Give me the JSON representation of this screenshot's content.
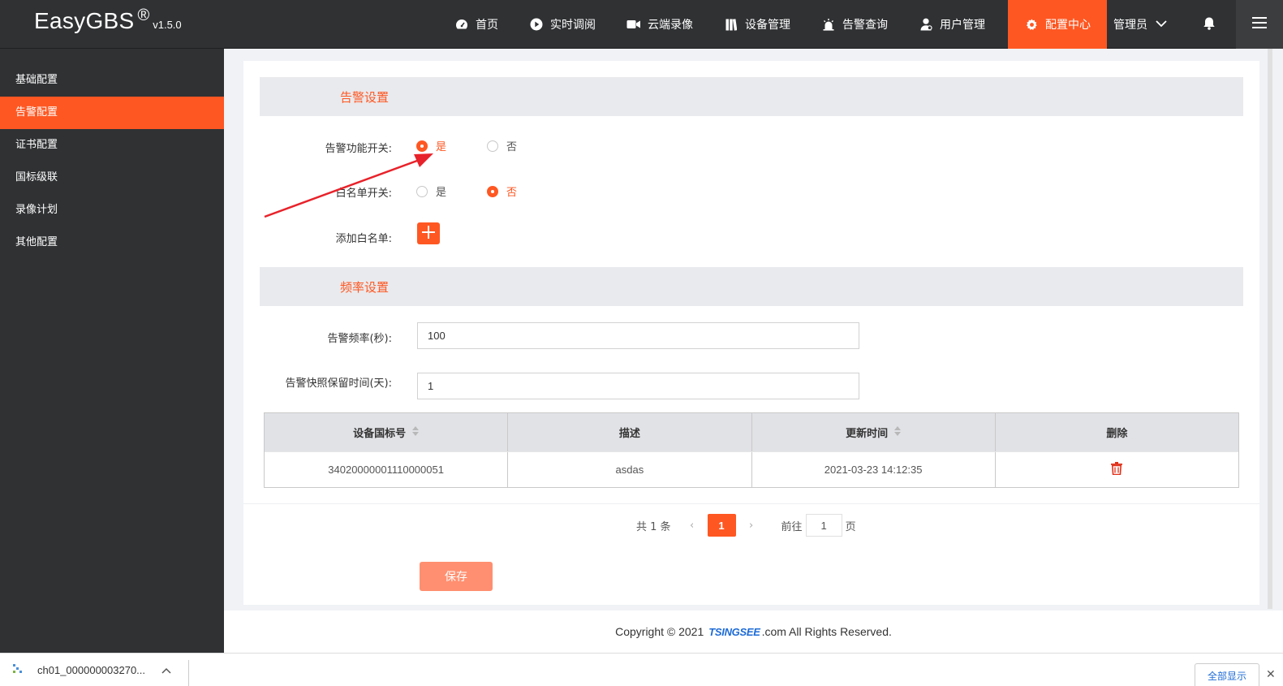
{
  "app": {
    "name": "EasyGBS",
    "reg_mark": "®",
    "version": "v1.5.0"
  },
  "nav": {
    "items": [
      {
        "label": "首页",
        "icon": "dashboard-icon"
      },
      {
        "label": "实时调阅",
        "icon": "play-icon"
      },
      {
        "label": "云端录像",
        "icon": "video-camera-icon"
      },
      {
        "label": "设备管理",
        "icon": "device-icon"
      },
      {
        "label": "告警查询",
        "icon": "alarm-icon"
      },
      {
        "label": "用户管理",
        "icon": "user-icon"
      },
      {
        "label": "配置中心",
        "icon": "gear-icon",
        "active": true
      }
    ],
    "user_label": "管理员"
  },
  "sidebar": {
    "items": [
      {
        "label": "基础配置"
      },
      {
        "label": "告警配置",
        "active": true
      },
      {
        "label": "证书配置"
      },
      {
        "label": "国标级联"
      },
      {
        "label": "录像计划"
      },
      {
        "label": "其他配置"
      }
    ]
  },
  "alarm_section": {
    "title": "告警设置",
    "alarm_switch": {
      "label": "告警功能开关:",
      "yes": "是",
      "no": "否",
      "selected": "yes"
    },
    "whitelist_switch": {
      "label": "白名单开关:",
      "yes": "是",
      "no": "否",
      "selected": "no"
    },
    "add_whitelist_label": "添加白名单:"
  },
  "frequency_section": {
    "title": "频率设置",
    "frequency": {
      "label": "告警频率(秒):",
      "value": "100"
    },
    "snapshot_retention": {
      "label": "告警快照保留时间(天):",
      "value": "1"
    }
  },
  "table": {
    "headers": [
      "设备国标号",
      "描述",
      "更新时间",
      "删除"
    ],
    "rows": [
      {
        "device_id": "34020000001110000051",
        "description": "asdas",
        "updated": "2021-03-23 14:12:35"
      }
    ]
  },
  "pager": {
    "total": "共 1 条",
    "current": "1",
    "goto_label": "前往",
    "goto_value": "1",
    "page_suffix": "页"
  },
  "save_label": "保存",
  "footer": {
    "prefix": "Copyright © 2021",
    "logo": "TSINGSEE",
    "suffix": ".com All Rights Reserved."
  },
  "taskbar": {
    "download_name": "ch01_000000003270...",
    "show_all": "全部显示"
  },
  "colors": {
    "accent": "#ff5722",
    "dark": "#2f3133",
    "save_disabled": "#ff8f70"
  }
}
